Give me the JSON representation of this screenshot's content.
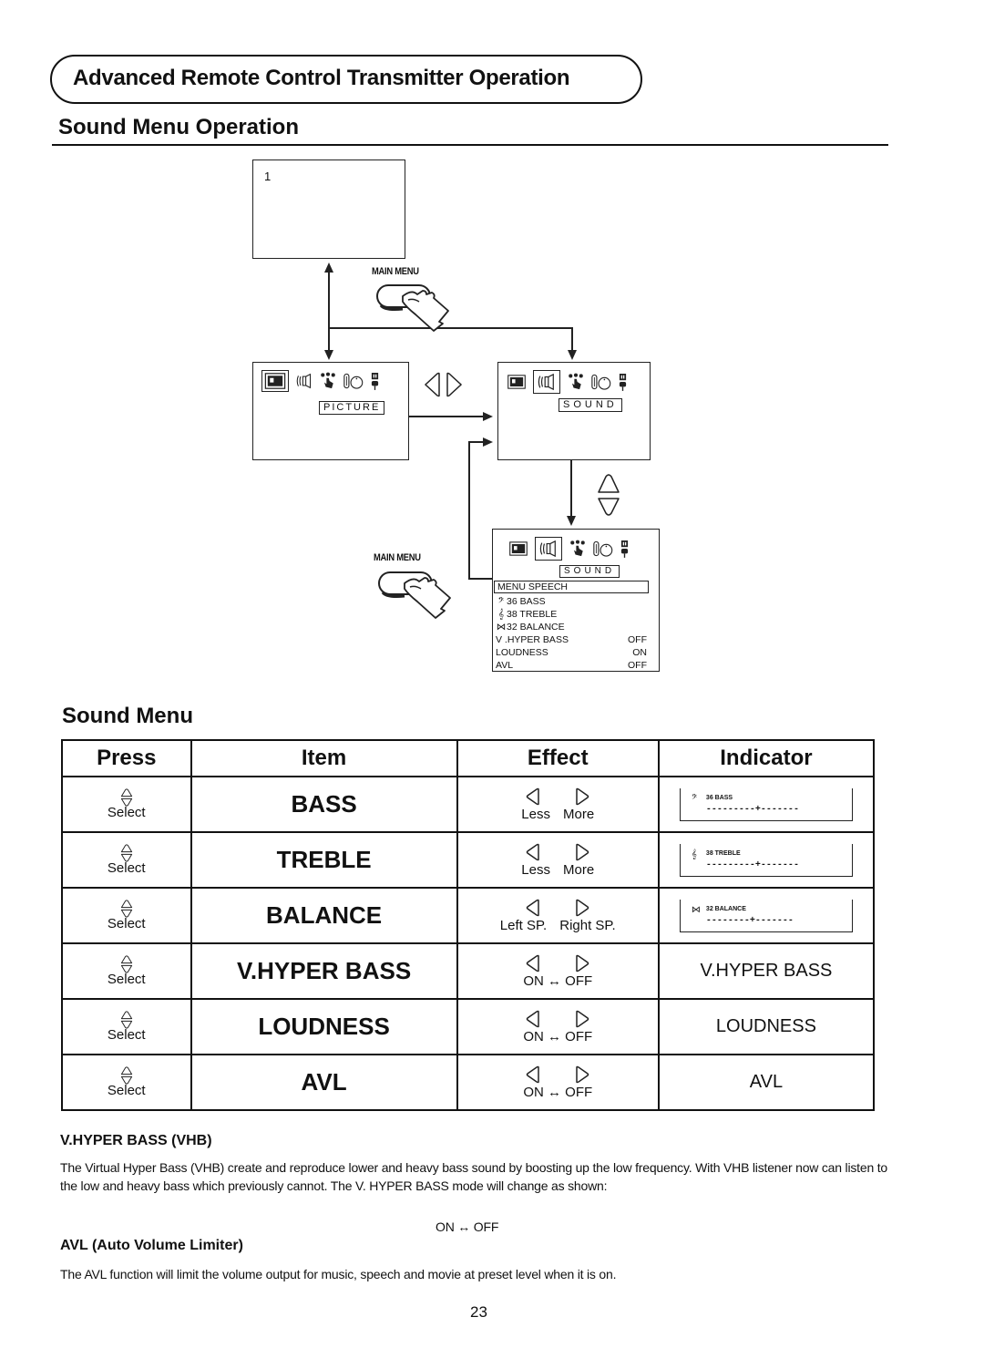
{
  "header": {
    "chapter_title": "Advanced Remote Control Transmitter Operation",
    "section_title": "Sound Menu Operation"
  },
  "diagram": {
    "screen1_label": "1",
    "main_menu_label_top": "MAIN MENU",
    "main_menu_label_bottom": "MAIN MENU",
    "picture_tag": "PICTURE",
    "sound_tag": "SOUND",
    "sound_tag_menu": "SOUND",
    "menu_header": "MENU SPEECH",
    "menu_items": [
      {
        "symbol": "bass-clef",
        "label": "36  BASS",
        "value": ""
      },
      {
        "symbol": "treble-clef",
        "label": "38  TREBLE",
        "value": ""
      },
      {
        "symbol": "balance",
        "label": "32  BALANCE",
        "value": ""
      },
      {
        "symbol": "",
        "label": "V .HYPER BASS",
        "value": "OFF"
      },
      {
        "symbol": "",
        "label": "LOUDNESS",
        "value": "ON"
      },
      {
        "symbol": "",
        "label": "AVL",
        "value": "OFF"
      }
    ]
  },
  "sound_menu": {
    "title": "Sound Menu",
    "columns": [
      "Press",
      "Item",
      "Effect",
      "Indicator"
    ],
    "rows": [
      {
        "press": "Select",
        "item": "BASS",
        "effect_left": "Less",
        "effect_right": "More",
        "indicator_type": "bar",
        "indicator_label": "36 BASS",
        "indicator_value": 36,
        "indicator_bar": "---------+-------"
      },
      {
        "press": "Select",
        "item": "TREBLE",
        "effect_left": "Less",
        "effect_right": "More",
        "indicator_type": "bar",
        "indicator_label": "38 TREBLE",
        "indicator_value": 38,
        "indicator_bar": "---------+-------"
      },
      {
        "press": "Select",
        "item": "BALANCE",
        "effect_left": "Left SP.",
        "effect_right": "Right SP.",
        "indicator_type": "bar",
        "indicator_label": "32 BALANCE",
        "indicator_value": 32,
        "indicator_bar": "--------+-------"
      },
      {
        "press": "Select",
        "item": "V.HYPER BASS",
        "effect_onoff": "ON ↔ OFF",
        "indicator_type": "text",
        "indicator_text": "V.HYPER BASS"
      },
      {
        "press": "Select",
        "item": "LOUDNESS",
        "effect_onoff": "ON ↔ OFF",
        "indicator_type": "text",
        "indicator_text": "LOUDNESS"
      },
      {
        "press": "Select",
        "item": "AVL",
        "effect_onoff": "ON ↔ OFF",
        "indicator_type": "text",
        "indicator_text": "AVL"
      }
    ]
  },
  "notes": {
    "vhb_title": "V.HYPER BASS (VHB)",
    "vhb_body": "The Virtual Hyper Bass (VHB) create and reproduce lower and heavy bass sound by boosting up the low frequency. With VHB listener now can listen to the low and heavy bass which previously cannot. The V. HYPER BASS mode will change as shown:",
    "vhb_cycle": "ON ↔ OFF",
    "avl_title": "AVL (Auto Volume Limiter)",
    "avl_body": "The AVL function will limit the volume output for music, speech and movie at preset level when it is on."
  },
  "footer": {
    "page_number": "23"
  }
}
